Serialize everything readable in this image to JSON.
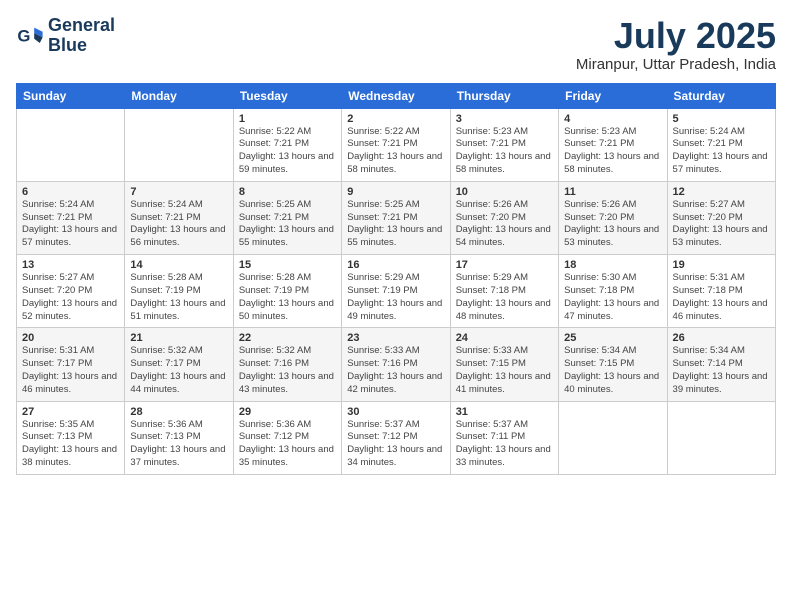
{
  "logo": {
    "line1": "General",
    "line2": "Blue"
  },
  "title": "July 2025",
  "location": "Miranpur, Uttar Pradesh, India",
  "days_of_week": [
    "Sunday",
    "Monday",
    "Tuesday",
    "Wednesday",
    "Thursday",
    "Friday",
    "Saturday"
  ],
  "weeks": [
    [
      {
        "day": "",
        "content": ""
      },
      {
        "day": "",
        "content": ""
      },
      {
        "day": "1",
        "content": "Sunrise: 5:22 AM\nSunset: 7:21 PM\nDaylight: 13 hours and 59 minutes."
      },
      {
        "day": "2",
        "content": "Sunrise: 5:22 AM\nSunset: 7:21 PM\nDaylight: 13 hours and 58 minutes."
      },
      {
        "day": "3",
        "content": "Sunrise: 5:23 AM\nSunset: 7:21 PM\nDaylight: 13 hours and 58 minutes."
      },
      {
        "day": "4",
        "content": "Sunrise: 5:23 AM\nSunset: 7:21 PM\nDaylight: 13 hours and 58 minutes."
      },
      {
        "day": "5",
        "content": "Sunrise: 5:24 AM\nSunset: 7:21 PM\nDaylight: 13 hours and 57 minutes."
      }
    ],
    [
      {
        "day": "6",
        "content": "Sunrise: 5:24 AM\nSunset: 7:21 PM\nDaylight: 13 hours and 57 minutes."
      },
      {
        "day": "7",
        "content": "Sunrise: 5:24 AM\nSunset: 7:21 PM\nDaylight: 13 hours and 56 minutes."
      },
      {
        "day": "8",
        "content": "Sunrise: 5:25 AM\nSunset: 7:21 PM\nDaylight: 13 hours and 55 minutes."
      },
      {
        "day": "9",
        "content": "Sunrise: 5:25 AM\nSunset: 7:21 PM\nDaylight: 13 hours and 55 minutes."
      },
      {
        "day": "10",
        "content": "Sunrise: 5:26 AM\nSunset: 7:20 PM\nDaylight: 13 hours and 54 minutes."
      },
      {
        "day": "11",
        "content": "Sunrise: 5:26 AM\nSunset: 7:20 PM\nDaylight: 13 hours and 53 minutes."
      },
      {
        "day": "12",
        "content": "Sunrise: 5:27 AM\nSunset: 7:20 PM\nDaylight: 13 hours and 53 minutes."
      }
    ],
    [
      {
        "day": "13",
        "content": "Sunrise: 5:27 AM\nSunset: 7:20 PM\nDaylight: 13 hours and 52 minutes."
      },
      {
        "day": "14",
        "content": "Sunrise: 5:28 AM\nSunset: 7:19 PM\nDaylight: 13 hours and 51 minutes."
      },
      {
        "day": "15",
        "content": "Sunrise: 5:28 AM\nSunset: 7:19 PM\nDaylight: 13 hours and 50 minutes."
      },
      {
        "day": "16",
        "content": "Sunrise: 5:29 AM\nSunset: 7:19 PM\nDaylight: 13 hours and 49 minutes."
      },
      {
        "day": "17",
        "content": "Sunrise: 5:29 AM\nSunset: 7:18 PM\nDaylight: 13 hours and 48 minutes."
      },
      {
        "day": "18",
        "content": "Sunrise: 5:30 AM\nSunset: 7:18 PM\nDaylight: 13 hours and 47 minutes."
      },
      {
        "day": "19",
        "content": "Sunrise: 5:31 AM\nSunset: 7:18 PM\nDaylight: 13 hours and 46 minutes."
      }
    ],
    [
      {
        "day": "20",
        "content": "Sunrise: 5:31 AM\nSunset: 7:17 PM\nDaylight: 13 hours and 46 minutes."
      },
      {
        "day": "21",
        "content": "Sunrise: 5:32 AM\nSunset: 7:17 PM\nDaylight: 13 hours and 44 minutes."
      },
      {
        "day": "22",
        "content": "Sunrise: 5:32 AM\nSunset: 7:16 PM\nDaylight: 13 hours and 43 minutes."
      },
      {
        "day": "23",
        "content": "Sunrise: 5:33 AM\nSunset: 7:16 PM\nDaylight: 13 hours and 42 minutes."
      },
      {
        "day": "24",
        "content": "Sunrise: 5:33 AM\nSunset: 7:15 PM\nDaylight: 13 hours and 41 minutes."
      },
      {
        "day": "25",
        "content": "Sunrise: 5:34 AM\nSunset: 7:15 PM\nDaylight: 13 hours and 40 minutes."
      },
      {
        "day": "26",
        "content": "Sunrise: 5:34 AM\nSunset: 7:14 PM\nDaylight: 13 hours and 39 minutes."
      }
    ],
    [
      {
        "day": "27",
        "content": "Sunrise: 5:35 AM\nSunset: 7:13 PM\nDaylight: 13 hours and 38 minutes."
      },
      {
        "day": "28",
        "content": "Sunrise: 5:36 AM\nSunset: 7:13 PM\nDaylight: 13 hours and 37 minutes."
      },
      {
        "day": "29",
        "content": "Sunrise: 5:36 AM\nSunset: 7:12 PM\nDaylight: 13 hours and 35 minutes."
      },
      {
        "day": "30",
        "content": "Sunrise: 5:37 AM\nSunset: 7:12 PM\nDaylight: 13 hours and 34 minutes."
      },
      {
        "day": "31",
        "content": "Sunrise: 5:37 AM\nSunset: 7:11 PM\nDaylight: 13 hours and 33 minutes."
      },
      {
        "day": "",
        "content": ""
      },
      {
        "day": "",
        "content": ""
      }
    ]
  ]
}
